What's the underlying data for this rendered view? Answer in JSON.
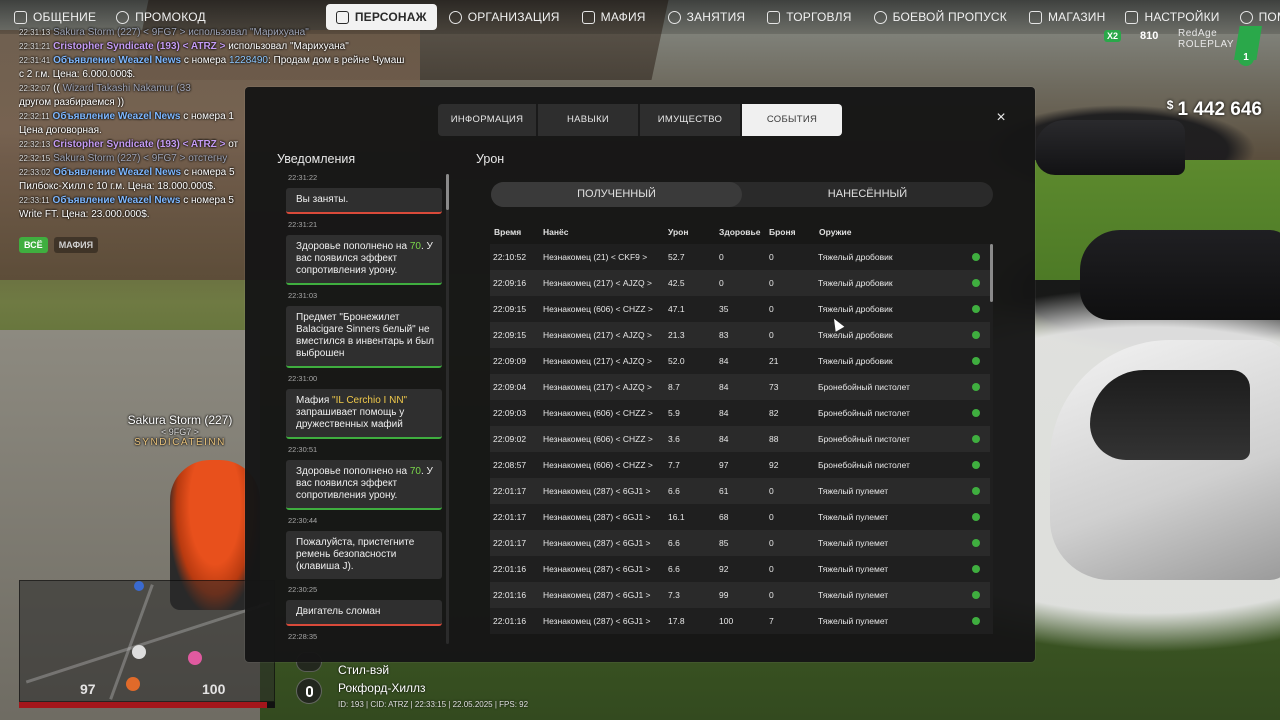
{
  "nav": {
    "left": [
      {
        "label": "ОБЩЕНИЕ",
        "icon": "chat-icon"
      },
      {
        "label": "ПРОМОКОД",
        "icon": "gift-icon"
      }
    ],
    "center": [
      {
        "label": "ПЕРСОНАЖ",
        "icon": "user-icon",
        "active": true
      },
      {
        "label": "ОРГАНИЗАЦИЯ",
        "icon": "group-icon"
      },
      {
        "label": "МАФИЯ",
        "icon": "mafia-icon"
      },
      {
        "label": "ЗАНЯТИЯ",
        "icon": "calendar-icon"
      },
      {
        "label": "ТОРГОВЛЯ",
        "icon": "chart-icon"
      },
      {
        "label": "БОЕВОЙ ПРОПУСК",
        "icon": "battlepass-icon"
      },
      {
        "label": "МАГАЗИН",
        "icon": "cart-icon"
      }
    ],
    "right": [
      {
        "label": "НАСТРОЙКИ",
        "icon": "gear-icon"
      },
      {
        "label": "ПОМОЩЬ",
        "icon": "help-icon"
      }
    ]
  },
  "chat": {
    "lines": [
      {
        "ts": "22:31:13",
        "parts": [
          {
            "t": "Sakura Storm (227) < 9FG7 > использовал \"Марихуана\"",
            "c": "c-dim"
          }
        ]
      },
      {
        "ts": "22:31:21",
        "parts": [
          {
            "t": "Cristopher Syndicate (193) < ATRZ > ",
            "c": "c-purple"
          },
          {
            "t": "использовал \"Марихуана\"",
            "c": "c-white"
          }
        ]
      },
      {
        "ts": "22:31:41",
        "parts": [
          {
            "t": "Объявление Weazel News",
            "c": "c-news"
          },
          {
            "t": " с номера ",
            "c": "c-white"
          },
          {
            "t": "1228490",
            "c": "c-blue"
          },
          {
            "t": ": Продам дом в рейне Чумаш",
            "c": "c-white"
          }
        ]
      },
      {
        "ts": "",
        "parts": [
          {
            "t": "с 2 г.м. Цена: 6.000.000$.",
            "c": "c-white"
          }
        ]
      },
      {
        "ts": "22:32:07",
        "parts": [
          {
            "t": "(( ",
            "c": "c-white"
          },
          {
            "t": "Wizard Takashi Nakamur (33",
            "c": "c-dim"
          }
        ]
      },
      {
        "ts": "",
        "parts": [
          {
            "t": "другом разбираемся ))",
            "c": "c-white"
          }
        ]
      },
      {
        "ts": "22:32:11",
        "parts": [
          {
            "t": "Объявление Weazel News",
            "c": "c-news"
          },
          {
            "t": " с номера 1",
            "c": "c-white"
          }
        ]
      },
      {
        "ts": "",
        "parts": [
          {
            "t": "Цена договорная.",
            "c": "c-white"
          }
        ]
      },
      {
        "ts": "22:32:13",
        "parts": [
          {
            "t": "Cristopher Syndicate (193) < ATRZ > ",
            "c": "c-purple"
          },
          {
            "t": "от",
            "c": "c-white"
          }
        ]
      },
      {
        "ts": "22:32:15",
        "parts": [
          {
            "t": "Sakura Storm (227) < 9FG7 > отстегну",
            "c": "c-dim"
          }
        ]
      },
      {
        "ts": "22:33:02",
        "parts": [
          {
            "t": "Объявление Weazel News",
            "c": "c-news"
          },
          {
            "t": " с номера 5",
            "c": "c-white"
          }
        ]
      },
      {
        "ts": "",
        "parts": [
          {
            "t": "Пилбокс-Хилл с 10 г.м. Цена: 18.000.000$.",
            "c": "c-white"
          }
        ]
      },
      {
        "ts": "22:33:11",
        "parts": [
          {
            "t": "Объявление Weazel News",
            "c": "c-news"
          },
          {
            "t": " с номера 5",
            "c": "c-white"
          }
        ]
      },
      {
        "ts": "",
        "parts": [
          {
            "t": "Write FT. Цена: 23.000.000$.",
            "c": "c-white"
          }
        ]
      }
    ],
    "tabs": [
      {
        "label": "ВСЁ",
        "active": true
      },
      {
        "label": "МАФИЯ",
        "active": false
      }
    ]
  },
  "hud": {
    "badge": "X2",
    "online": "810",
    "brand_line1": "RedAge",
    "brand_line2": "ROLEPLAY",
    "server_num": "1",
    "money_currency": "$",
    "money": "1 442 646"
  },
  "player": {
    "name": "Sakura Storm (227)",
    "tag": "< 9FG7 >",
    "family": "SYNDICATEINN"
  },
  "minimap": {
    "health": "97",
    "armor": "100"
  },
  "location": {
    "street": "Стил-вэй",
    "area": "Рокфорд-Хиллз",
    "info": "ID: 193 | CID: ATRZ | 22:33:15 | 22.05.2025 | FPS: 92"
  },
  "modal": {
    "tabs": [
      {
        "label": "ИНФОРМАЦИЯ",
        "active": false
      },
      {
        "label": "НАВЫКИ",
        "active": false
      },
      {
        "label": "ИМУЩЕСТВО",
        "active": false
      },
      {
        "label": "СОБЫТИЯ",
        "active": true
      }
    ],
    "close": "×",
    "notifications_title": "Уведомления",
    "notifications": [
      {
        "ts": "22:31:22",
        "text": "Вы заняты.",
        "status": "red"
      },
      {
        "ts": "22:31:21",
        "pre": "Здоровье пополнено на ",
        "hl": "70",
        "post": ". У вас появился эффект сопротивления урону.",
        "status": "green"
      },
      {
        "ts": "22:31:03",
        "text": "Предмет \"Бронежилет Balacigare Sinners белый\" не вместился в инвентарь и был выброшен",
        "status": "green"
      },
      {
        "ts": "22:31:00",
        "pre": "Мафия ",
        "hly": "\"IL Cerchio I NN\"",
        "post": " запрашивает помощь у дружественных мафий",
        "status": "green"
      },
      {
        "ts": "22:30:51",
        "pre": "Здоровье пополнено на ",
        "hl": "70",
        "post": ". У вас появился эффект сопротивления урону.",
        "status": "green"
      },
      {
        "ts": "22:30:44",
        "text": "Пожалуйста, пристегните ремень безопасности (клавиша J).",
        "status": "none"
      },
      {
        "ts": "22:30:25",
        "text": "Двигатель сломан",
        "status": "red"
      },
      {
        "ts": "22:28:35",
        "text": "",
        "status": "none"
      }
    ],
    "damage_title": "Урон",
    "damage_switch": [
      {
        "label": "ПОЛУЧЕННЫЙ",
        "active": true
      },
      {
        "label": "НАНЕСЁННЫЙ",
        "active": false
      }
    ],
    "damage_columns": [
      "Время",
      "Нанёс",
      "Урон",
      "Здоровье",
      "Броня",
      "Оружие"
    ],
    "damage_rows": [
      [
        "22:10:52",
        "Незнакомец (21) < CKF9 >",
        "52.7",
        "0",
        "0",
        "Тяжелый дробовик"
      ],
      [
        "22:09:16",
        "Незнакомец (217) < AJZQ >",
        "42.5",
        "0",
        "0",
        "Тяжелый дробовик"
      ],
      [
        "22:09:15",
        "Незнакомец (606) < CHZZ >",
        "47.1",
        "35",
        "0",
        "Тяжелый дробовик"
      ],
      [
        "22:09:15",
        "Незнакомец (217) < AJZQ >",
        "21.3",
        "83",
        "0",
        "Тяжелый дробовик"
      ],
      [
        "22:09:09",
        "Незнакомец (217) < AJZQ >",
        "52.0",
        "84",
        "21",
        "Тяжелый дробовик"
      ],
      [
        "22:09:04",
        "Незнакомец (217) < AJZQ >",
        "8.7",
        "84",
        "73",
        "Бронебойный пистолет"
      ],
      [
        "22:09:03",
        "Незнакомец (606) < CHZZ >",
        "5.9",
        "84",
        "82",
        "Бронебойный пистолет"
      ],
      [
        "22:09:02",
        "Незнакомец (606) < CHZZ >",
        "3.6",
        "84",
        "88",
        "Бронебойный пистолет"
      ],
      [
        "22:08:57",
        "Незнакомец (606) < CHZZ >",
        "7.7",
        "97",
        "92",
        "Бронебойный пистолет"
      ],
      [
        "22:01:17",
        "Незнакомец (287) < 6GJ1 >",
        "6.6",
        "61",
        "0",
        "Тяжелый пулемет"
      ],
      [
        "22:01:17",
        "Незнакомец (287) < 6GJ1 >",
        "16.1",
        "68",
        "0",
        "Тяжелый пулемет"
      ],
      [
        "22:01:17",
        "Незнакомец (287) < 6GJ1 >",
        "6.6",
        "85",
        "0",
        "Тяжелый пулемет"
      ],
      [
        "22:01:16",
        "Незнакомец (287) < 6GJ1 >",
        "6.6",
        "92",
        "0",
        "Тяжелый пулемет"
      ],
      [
        "22:01:16",
        "Незнакомец (287) < 6GJ1 >",
        "7.3",
        "99",
        "0",
        "Тяжелый пулемет"
      ],
      [
        "22:01:16",
        "Незнакомец (287) < 6GJ1 >",
        "17.8",
        "100",
        "7",
        "Тяжелый пулемет"
      ]
    ]
  },
  "colors": {
    "accent_green": "#3fae3f",
    "alert_red": "#d94a3a",
    "news_blue": "#7db7ff",
    "hp_red": "#a3161b"
  }
}
